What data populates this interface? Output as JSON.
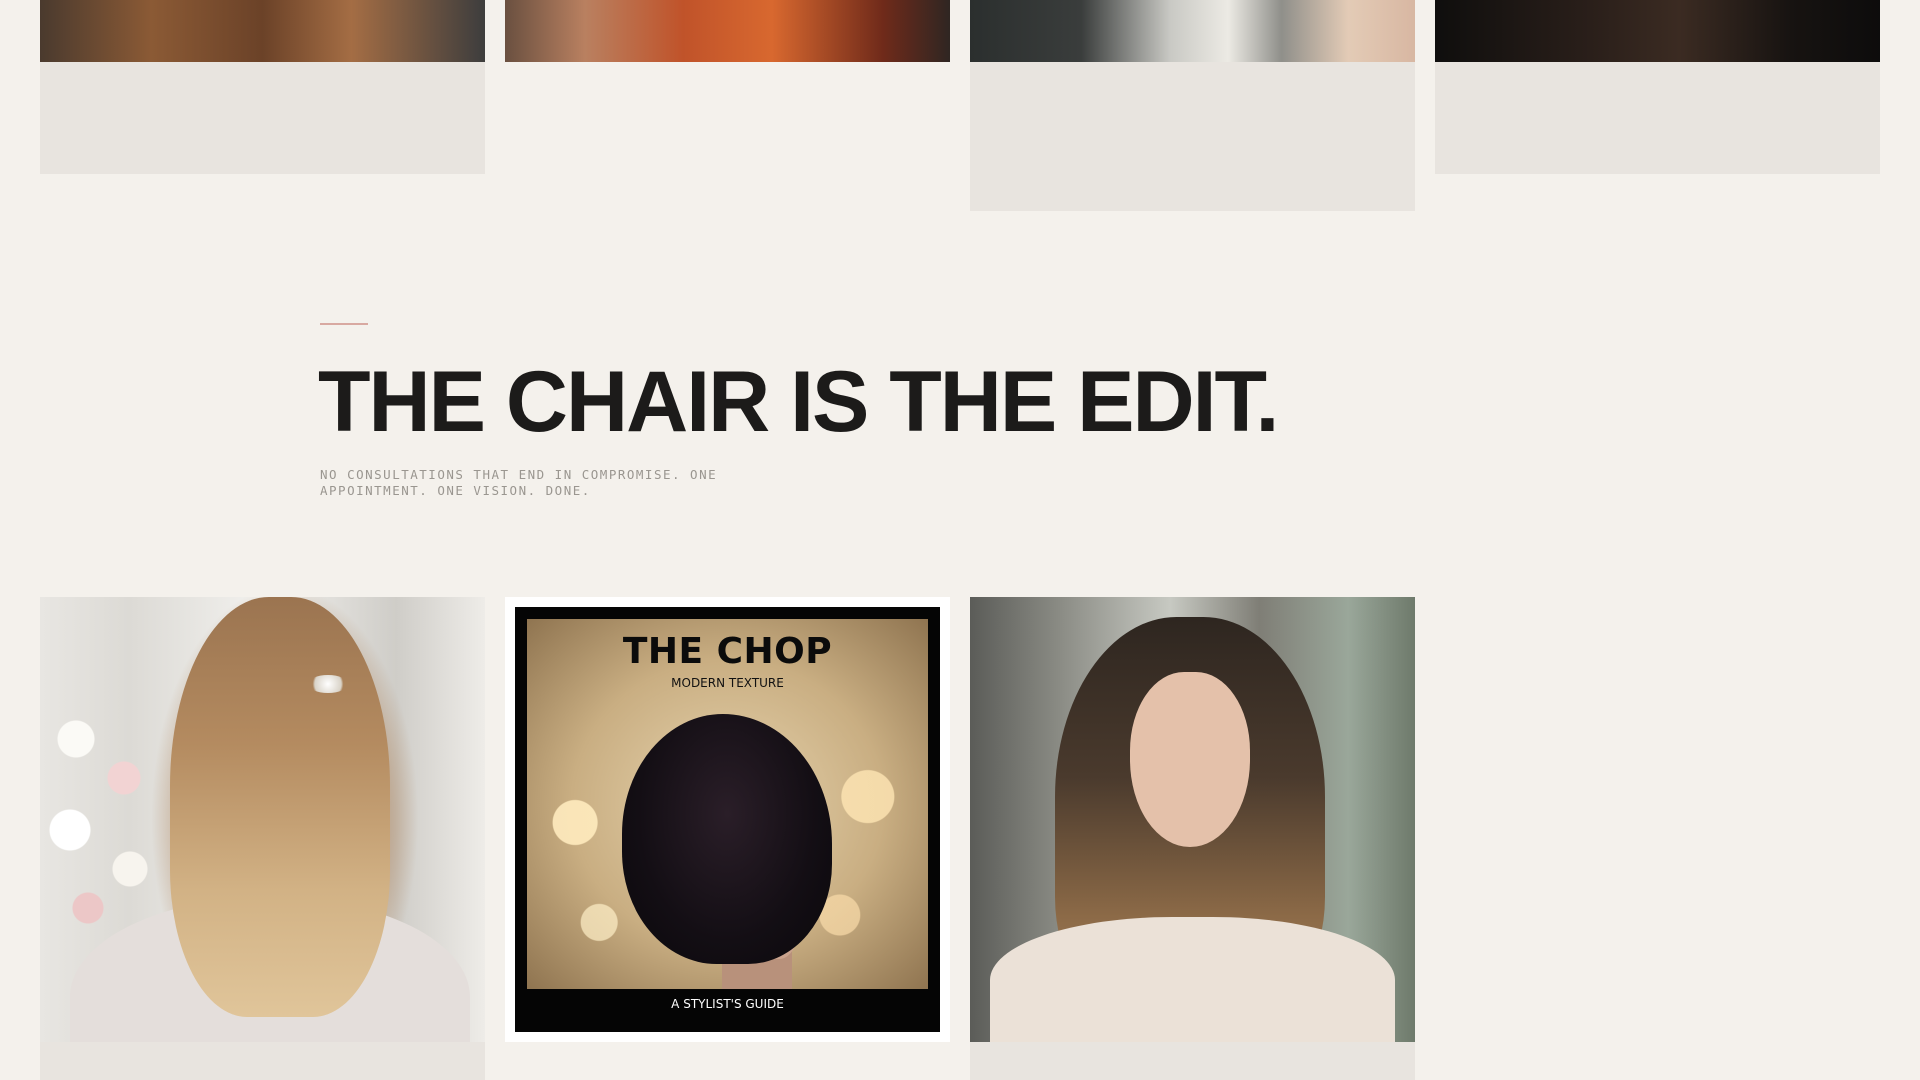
{
  "top_row": [
    {
      "kind": "photo-card",
      "photo": "woman with brunette waves"
    },
    {
      "kind": "photo-card",
      "photo": "woman with copper red hair"
    },
    {
      "kind": "photo-card",
      "photo": "woman with silver grey waves"
    },
    {
      "kind": "photo-card",
      "photo": "woman with dark curly hair"
    }
  ],
  "section": {
    "headline": "THE CHAIR IS THE EDIT.",
    "subtext": "NO CONSULTATIONS THAT END IN COMPROMISE. ONE APPOINTMENT. ONE VISION. DONE.",
    "accent_color": "#d8a9a1"
  },
  "bottom_row": {
    "cover": {
      "title": "THE CHOP",
      "subtitle": "MODERN TEXTURE",
      "footer": "A STYLIST'S GUIDE"
    }
  },
  "colors": {
    "background": "#f4f1ec",
    "caption_panel": "#e8e4df",
    "headline": "#1c1b1a",
    "subtext": "#9a9690"
  }
}
